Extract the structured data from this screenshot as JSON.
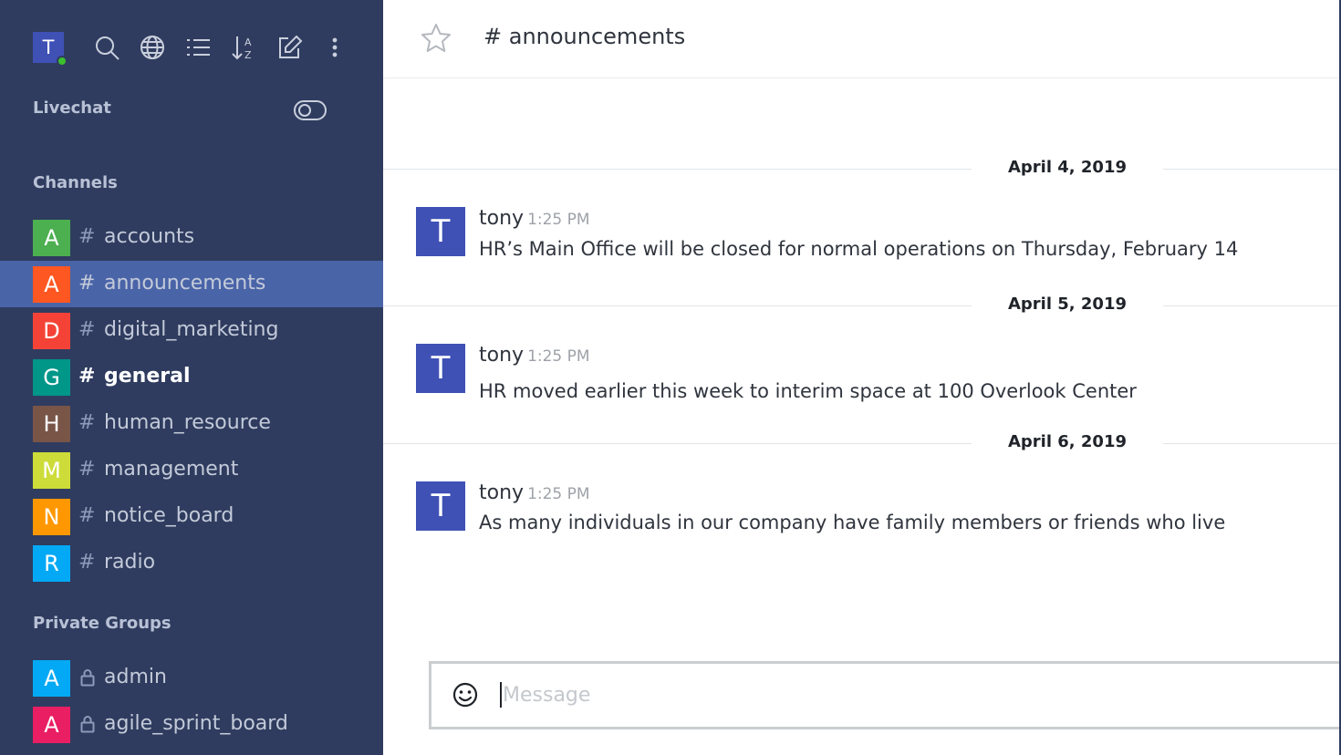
{
  "user": {
    "initial": "T",
    "status": "online"
  },
  "toolbar": {
    "icons": [
      "search-icon",
      "globe-icon",
      "list-icon",
      "sort-icon",
      "compose-icon",
      "kebab-icon"
    ]
  },
  "sidebar": {
    "livechat_label": "Livechat",
    "channels_label": "Channels",
    "private_groups_label": "Private Groups",
    "channels": [
      {
        "initial": "A",
        "name": "accounts",
        "color": "#4caf50",
        "active": false,
        "unread": false
      },
      {
        "initial": "A",
        "name": "announcements",
        "color": "#ff5722",
        "active": true,
        "unread": false
      },
      {
        "initial": "D",
        "name": "digital_marketing",
        "color": "#f44336",
        "active": false,
        "unread": false
      },
      {
        "initial": "G",
        "name": "general",
        "color": "#009688",
        "active": false,
        "unread": true
      },
      {
        "initial": "H",
        "name": "human_resource",
        "color": "#795548",
        "active": false,
        "unread": false
      },
      {
        "initial": "M",
        "name": "management",
        "color": "#cddc39",
        "active": false,
        "unread": false
      },
      {
        "initial": "N",
        "name": "notice_board",
        "color": "#ff9800",
        "active": false,
        "unread": false
      },
      {
        "initial": "R",
        "name": "radio",
        "color": "#03a9f4",
        "active": false,
        "unread": false
      }
    ],
    "groups": [
      {
        "initial": "A",
        "name": "admin",
        "color": "#03a9f4"
      },
      {
        "initial": "A",
        "name": "agile_sprint_board",
        "color": "#e91e63"
      }
    ]
  },
  "header": {
    "title": "# announcements"
  },
  "messages": [
    {
      "date": "April 4, 2019",
      "author": "tony",
      "initial": "T",
      "time": "1:25 PM",
      "text": "HR’s Main Office will be closed for normal operations on Thursday, February 14"
    },
    {
      "date": "April 5, 2019",
      "author": "tony",
      "initial": "T",
      "time": "1:25 PM",
      "text": "HR moved earlier this week to interim space at 100 Overlook Center"
    },
    {
      "date": "April 6, 2019",
      "author": "tony",
      "initial": "T",
      "time": "1:25 PM",
      "text": "As many individuals in our company have family members or friends who live in area"
    }
  ],
  "composer": {
    "placeholder": "Message"
  }
}
